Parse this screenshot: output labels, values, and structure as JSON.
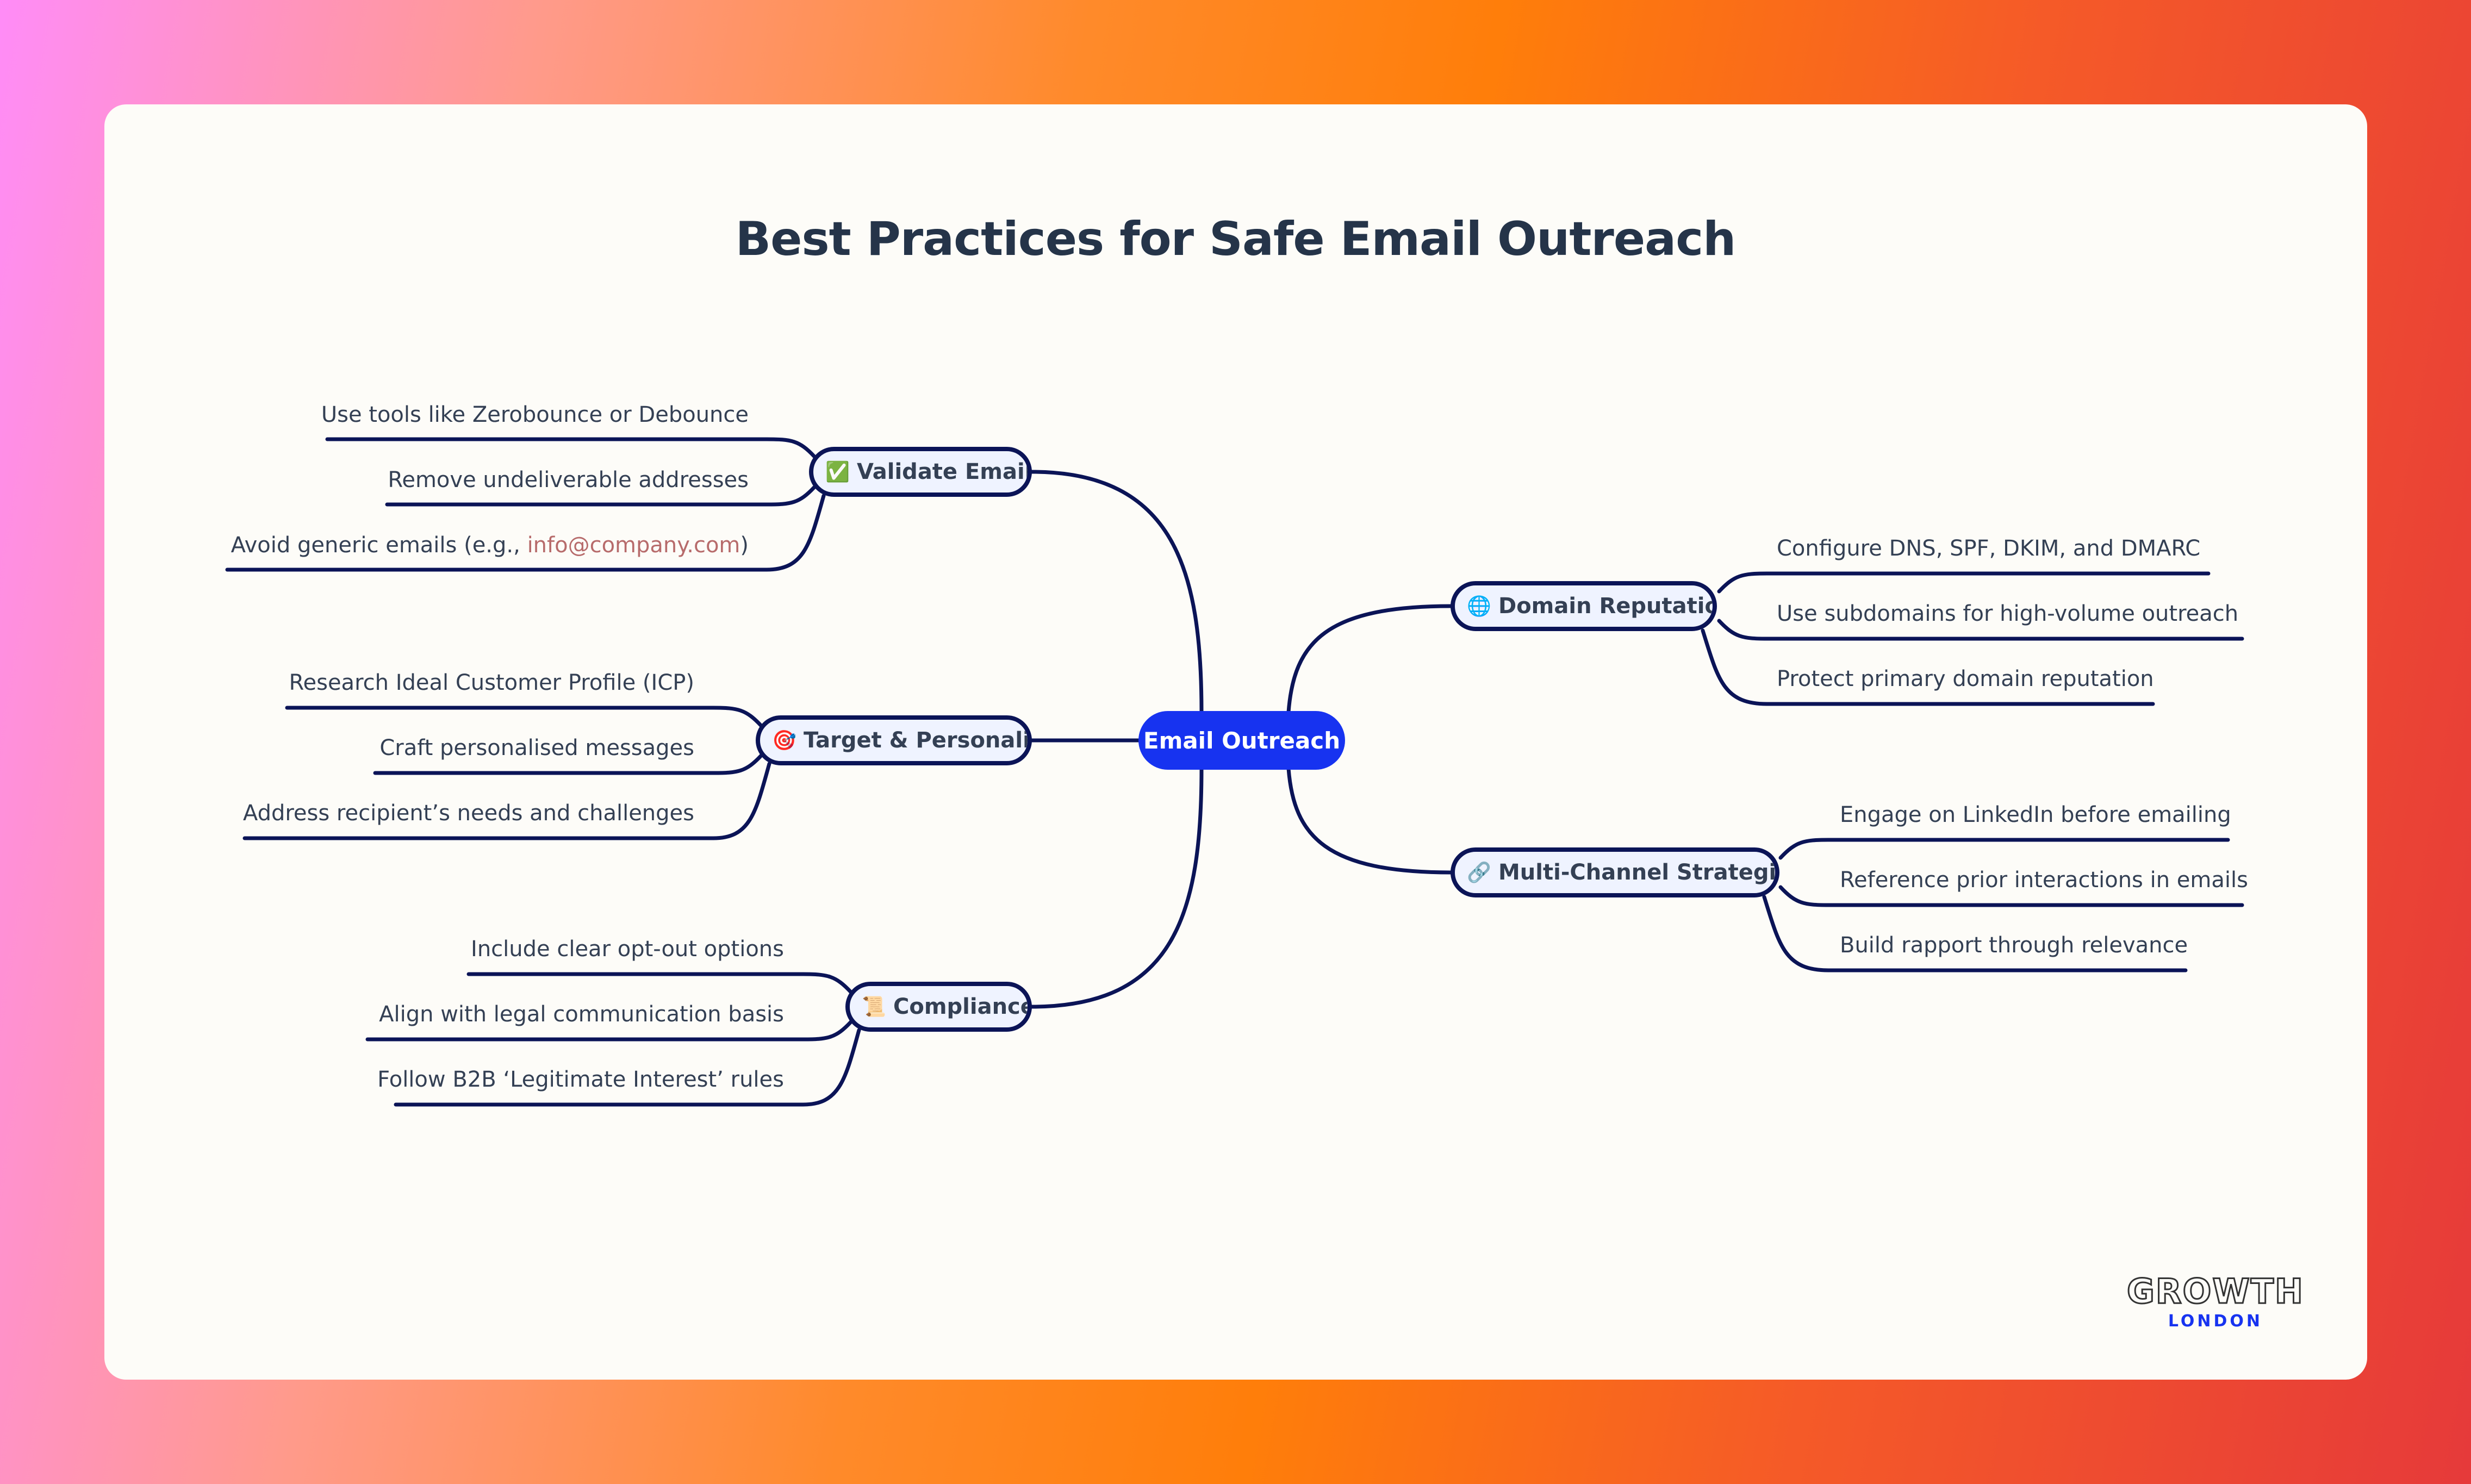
{
  "title": "Best Practices for Safe Email Outreach",
  "colors": {
    "root": "#1733f0",
    "line": "#0b1457",
    "text": "#344054",
    "title": "#253449",
    "email_highlight": "#b76b6b",
    "card": "#fdfcf8"
  },
  "root": {
    "label": "Email Outreach"
  },
  "branches": [
    {
      "id": "validate",
      "icon": "✅",
      "icon_name": "check-mark-icon",
      "label": "Validate Emails",
      "children": [
        "Use tools like Zerobounce or Debounce",
        "Remove undeliverable addresses",
        "Avoid generic emails (e.g., info@company.com)"
      ],
      "highlight": {
        "prefix": "Avoid generic emails (e.g., ",
        "email": "info@company.com",
        "suffix": ")"
      }
    },
    {
      "id": "target",
      "icon": "🎯",
      "icon_name": "target-icon",
      "label": "Target & Personalise",
      "children": [
        "Research Ideal Customer Profile (ICP)",
        "Craft personalised messages",
        "Address recipient’s needs and challenges"
      ]
    },
    {
      "id": "compliance",
      "icon": "📜",
      "icon_name": "scroll-icon",
      "label": "Compliance",
      "children": [
        "Include clear opt-out options",
        "Align with legal communication basis",
        "Follow B2B ‘Legitimate Interest’ rules"
      ]
    },
    {
      "id": "domain",
      "icon": "🌐",
      "icon_name": "globe-icon",
      "label": "Domain Reputation",
      "children": [
        "Configure DNS, SPF, DKIM, and DMARC",
        "Use subdomains for high-volume outreach",
        "Protect primary domain reputation"
      ]
    },
    {
      "id": "multichannel",
      "icon": "🔗",
      "icon_name": "link-icon",
      "label": "Multi-Channel Strategies",
      "children": [
        "Engage on LinkedIn before emailing",
        "Reference prior interactions in emails",
        "Build rapport through relevance"
      ]
    }
  ],
  "logo": {
    "main": "GROWTH",
    "sub": "LONDON"
  }
}
